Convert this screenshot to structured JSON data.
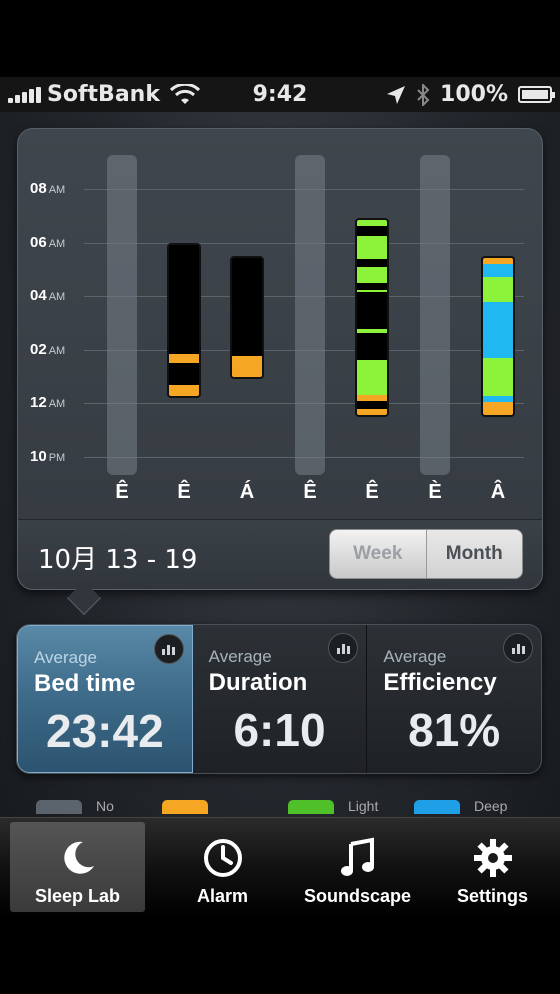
{
  "status_bar": {
    "carrier": "SoftBank",
    "time": "9:42",
    "battery": "100%"
  },
  "chart_data": {
    "type": "bar",
    "y_ticks": [
      {
        "hour": "08",
        "suffix": "AM"
      },
      {
        "hour": "06",
        "suffix": "AM"
      },
      {
        "hour": "04",
        "suffix": "AM"
      },
      {
        "hour": "02",
        "suffix": "AM"
      },
      {
        "hour": "12",
        "suffix": "AM"
      },
      {
        "hour": "10",
        "suffix": "PM"
      }
    ],
    "ylim_hours_from_10pm": [
      0,
      11
    ],
    "days": [
      "Ê",
      "Ê",
      "Á",
      "Ê",
      "Ê",
      "È",
      "Â"
    ],
    "bars": [
      {
        "day_index": 1,
        "start": 2.2,
        "end": 8.0
      },
      {
        "day_index": 2,
        "start": 2.9,
        "end": 7.5
      },
      {
        "day_index": 4,
        "start": 1.5,
        "end": 8.9
      },
      {
        "day_index": 5,
        "start": null,
        "end": null
      },
      {
        "day_index": 6,
        "start": 1.5,
        "end": 7.5
      }
    ]
  },
  "colors": {
    "awake": "#f5a623",
    "light": "#8cf23a",
    "deep": "#1fb8f0",
    "none": "#5b646c",
    "accent": "#3e6c8a"
  },
  "date_range": "10月 13 - 19",
  "segmented": {
    "week": "Week",
    "month": "Month",
    "selected": "Month"
  },
  "stats": [
    {
      "avg": "Average",
      "title": "Bed time",
      "value": "23:42",
      "active": true
    },
    {
      "avg": "Average",
      "title": "Duration",
      "value": "6:10",
      "active": false
    },
    {
      "avg": "Average",
      "title": "Efficiency",
      "value": "81%",
      "active": false
    }
  ],
  "legend": [
    {
      "color": "#5b646c",
      "label": "No"
    },
    {
      "color": "#f5a623",
      "label": ""
    },
    {
      "color": "#4fbf2a",
      "label": "Light"
    },
    {
      "color": "#1fa0e6",
      "label": "Deep"
    }
  ],
  "tabs": [
    {
      "label": "Sleep Lab",
      "icon": "moon-icon",
      "active": true
    },
    {
      "label": "Alarm",
      "icon": "clock-icon",
      "active": false
    },
    {
      "label": "Soundscape",
      "icon": "music-note-icon",
      "active": false
    },
    {
      "label": "Settings",
      "icon": "gear-icon",
      "active": false
    }
  ]
}
